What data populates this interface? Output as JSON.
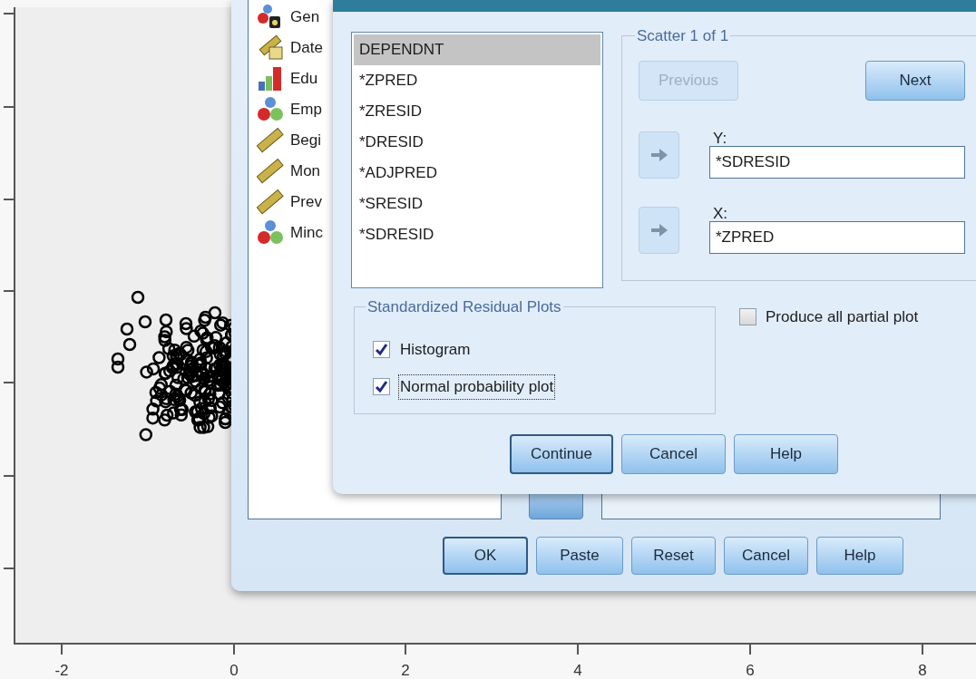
{
  "plot": {
    "x_ticks": [
      "-2",
      "0",
      "2",
      "4",
      "6",
      "8"
    ]
  },
  "main_dialog": {
    "variables": [
      {
        "label": "Gen",
        "kind": "nominal_string"
      },
      {
        "label": "Date",
        "kind": "date"
      },
      {
        "label": "Edu",
        "kind": "ordinal"
      },
      {
        "label": "Emp",
        "kind": "nominal"
      },
      {
        "label": "Begi",
        "kind": "scale"
      },
      {
        "label": "Mon",
        "kind": "scale"
      },
      {
        "label": "Prev",
        "kind": "scale"
      },
      {
        "label": "Minc",
        "kind": "nominal"
      }
    ],
    "buttons": [
      {
        "label": "OK",
        "default": true
      },
      {
        "label": "Paste",
        "default": false
      },
      {
        "label": "Reset",
        "default": false
      },
      {
        "label": "Cancel",
        "default": false
      },
      {
        "label": "Help",
        "default": false
      }
    ]
  },
  "plots_dialog": {
    "source_list": [
      {
        "label": "DEPENDNT",
        "selected": true
      },
      {
        "label": "*ZPRED",
        "selected": false
      },
      {
        "label": "*ZRESID",
        "selected": false
      },
      {
        "label": "*DRESID",
        "selected": false
      },
      {
        "label": "*ADJPRED",
        "selected": false
      },
      {
        "label": "*SRESID",
        "selected": false
      },
      {
        "label": "*SDRESID",
        "selected": false
      }
    ],
    "scatter": {
      "title": "Scatter 1 of 1",
      "previous": {
        "label": "Previous",
        "disabled": true
      },
      "next": {
        "label": "Next",
        "disabled": false
      },
      "axes": [
        {
          "label": "Y:",
          "value": "*SDRESID"
        },
        {
          "label": "X:",
          "value": "*ZPRED"
        }
      ]
    },
    "residual_plots": {
      "title": "Standardized Residual Plots",
      "options": [
        {
          "label": "Histogram",
          "checked": true,
          "focused": false
        },
        {
          "label": "Normal probability plot",
          "checked": true,
          "focused": true
        }
      ]
    },
    "partial_plots": {
      "label": "Produce all partial plot",
      "checked": false
    },
    "buttons": [
      {
        "label": "Continue",
        "default": true
      },
      {
        "label": "Cancel",
        "default": false
      },
      {
        "label": "Help",
        "default": false
      }
    ]
  }
}
